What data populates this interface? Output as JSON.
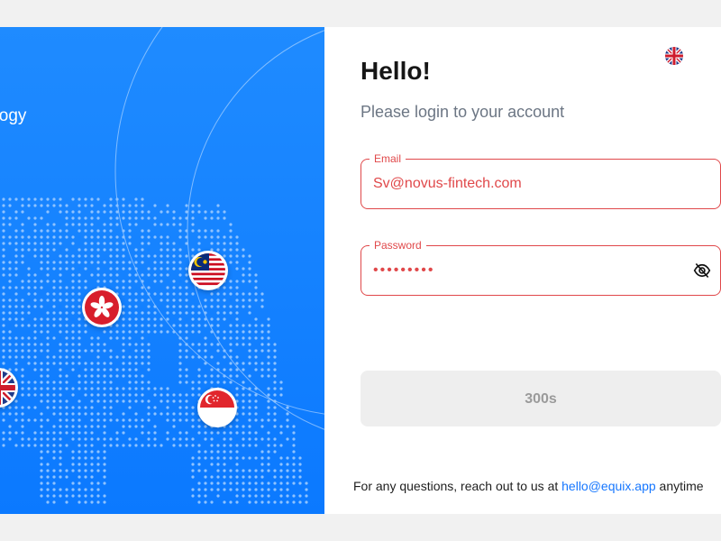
{
  "hero": {
    "tagline": "ology",
    "flags": [
      {
        "name": "uk",
        "icon": "uk-flag-icon"
      },
      {
        "name": "hong-kong",
        "icon": "hong-kong-flag-icon"
      },
      {
        "name": "malaysia",
        "icon": "malaysia-flag-icon"
      },
      {
        "name": "singapore",
        "icon": "singapore-flag-icon"
      }
    ],
    "colors": {
      "background": "#0b79ff",
      "dots": "#8fc3ff"
    }
  },
  "language": {
    "icon": "uk-flag-icon"
  },
  "login": {
    "title": "Hello!",
    "subtitle": "Please login to your account",
    "email": {
      "label": "Email",
      "value": "Sv@novus-fintech.com"
    },
    "password": {
      "label": "Password",
      "masked_value": "•••••••••",
      "toggle_icon": "eye-off-icon"
    },
    "submit_label": "300s"
  },
  "footer": {
    "text": "For any questions, reach out to us at ",
    "link": "hello@equix.app",
    "suffix": " anytime"
  },
  "colors": {
    "error": "#e0484a",
    "accent": "#1677ff",
    "disabled_bg": "#eeeeee"
  }
}
